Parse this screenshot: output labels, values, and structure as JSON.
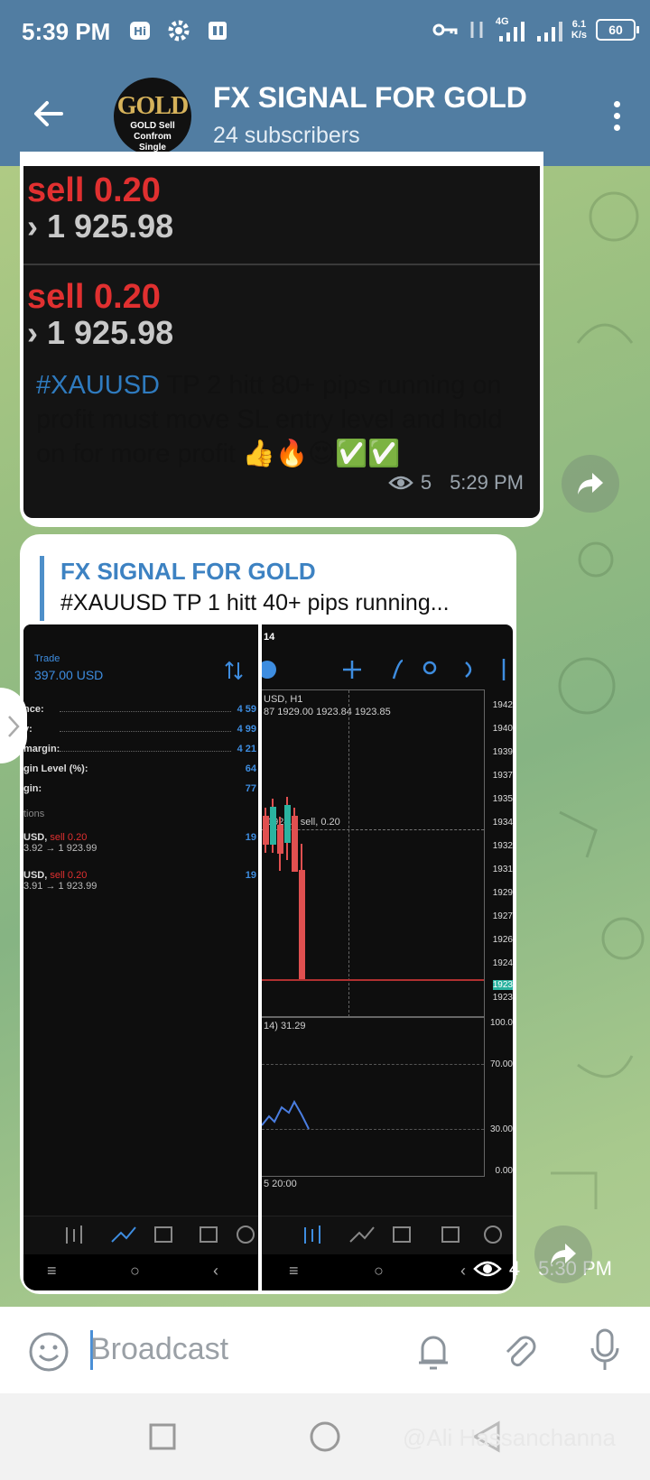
{
  "status_bar": {
    "time": "5:39 PM",
    "network": "4G",
    "speed_value": "6.1",
    "speed_unit": "K/s",
    "battery": "60"
  },
  "header": {
    "channel_name": "FX SIGNAL FOR GOLD",
    "subscribers": "24 subscribers",
    "avatar_text": "GOLD",
    "avatar_line1": "GOLD Sell",
    "avatar_line2": "Confrom",
    "avatar_line3": "Single"
  },
  "message1": {
    "image_lines": [
      {
        "label": "sell 0.20",
        "price": "1 925.98"
      },
      {
        "label": "sell 0.20",
        "price": "1 925.98"
      }
    ],
    "hashtag": "#XAUUSD",
    "text": "  TP 2  hitt 80+ pips running on profit must move SL entry level and hold on for more profit 👍🔥😍✅✅",
    "views": "5",
    "time": "5:29 PM"
  },
  "message2": {
    "reply_title": "FX SIGNAL FOR GOLD",
    "reply_text": "#XAUUSD  TP 1  hitt 40+ pips running...",
    "views": "4",
    "time": "5:30 PM",
    "left_shot": {
      "trade_label": "Trade",
      "balance": "397.00 USD",
      "rows": [
        {
          "label": "nce:",
          "value": "4 59"
        },
        {
          "label": "y:",
          "value": "4 99"
        },
        {
          "label": "margin:",
          "value": "4 21"
        },
        {
          "label": "gin Level (%):",
          "value": "64"
        },
        {
          "label": "gin:",
          "value": "77"
        }
      ],
      "section": "tions",
      "positions": [
        {
          "sym": "USD,",
          "side": "sell 0.20",
          "prices": "3.92 → 1 923.99",
          "pl": "19"
        },
        {
          "sym": "USD,",
          "side": "sell 0.20",
          "prices": "3.91 → 1 923.99",
          "pl": "19"
        }
      ]
    },
    "right_shot": {
      "time_label": "14",
      "symbol": "USD, H1",
      "ohlc": "87 1929.00 1923.84 1923.85",
      "order_label": "sell, 0.20",
      "order_prefix": "1924.4",
      "price_labels": [
        "1942",
        "1940",
        "1939",
        "1937",
        "1935",
        "1934",
        "1932",
        "1931",
        "1929",
        "1927",
        "1926",
        "1924",
        "1923"
      ],
      "current_price": "1923",
      "indicator": "14) 31.29",
      "osc_labels": [
        "100.0",
        "70.00",
        "30.00",
        "0.00"
      ],
      "time_axis": "5 20:00"
    }
  },
  "input": {
    "placeholder": "Broadcast"
  },
  "watermark": "@Ali Hassanchanna"
}
